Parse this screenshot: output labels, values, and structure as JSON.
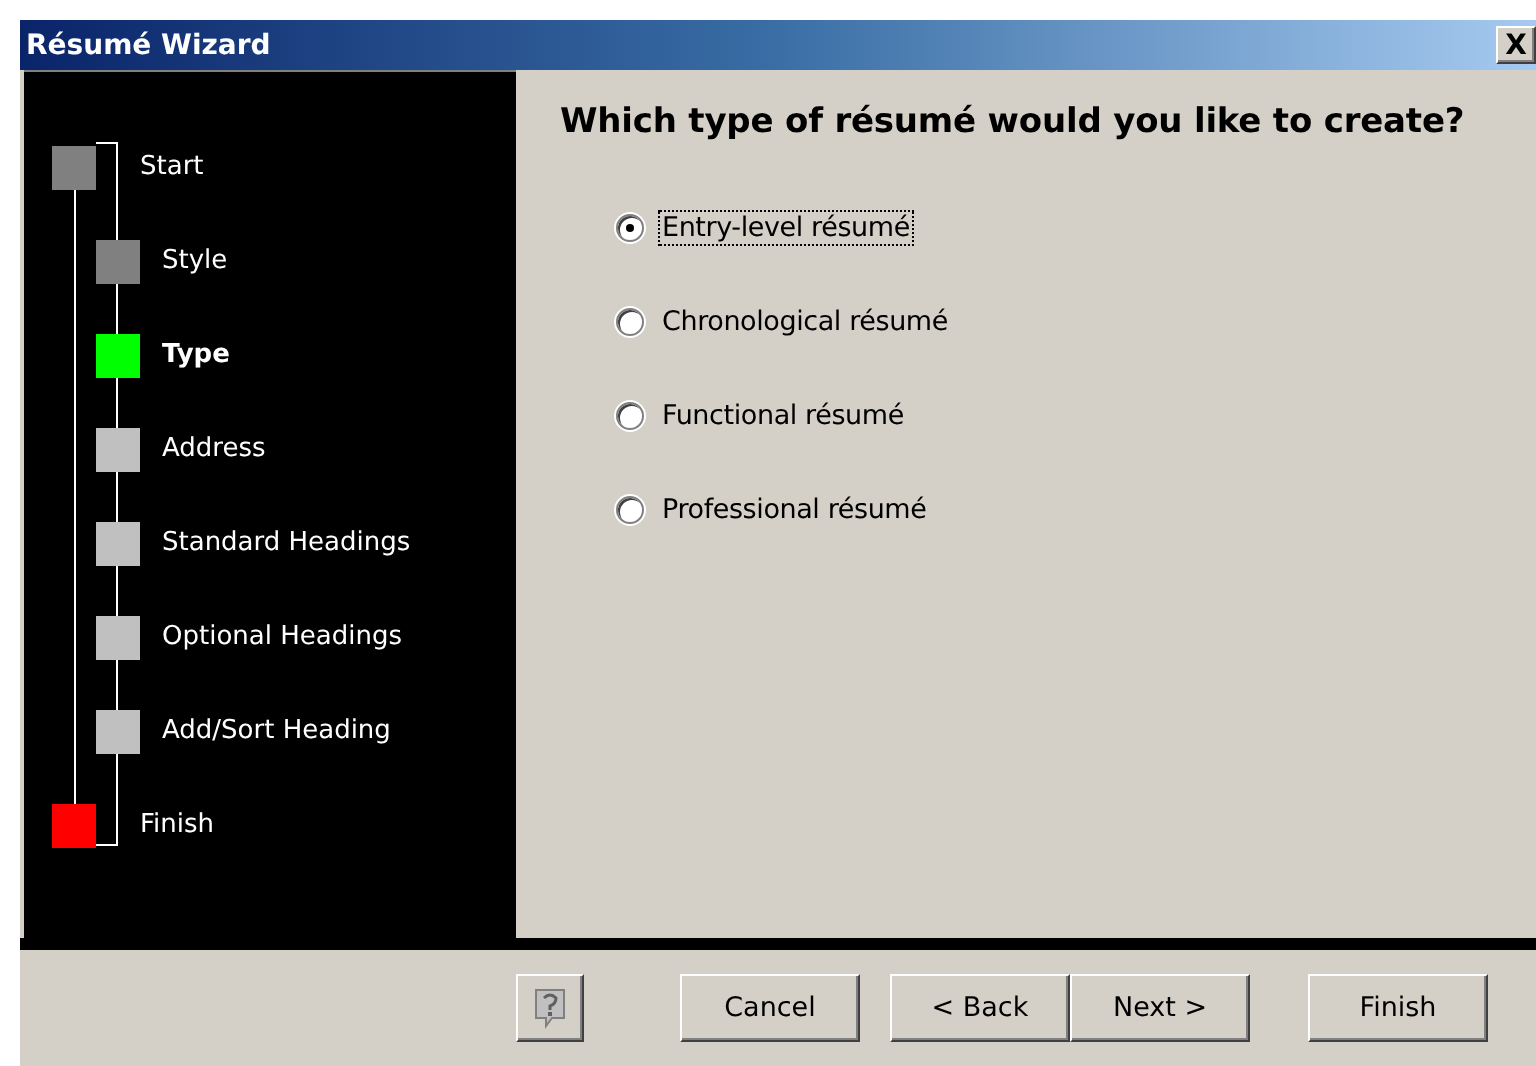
{
  "window": {
    "title": "Résumé Wizard",
    "close_label": "X"
  },
  "steps": [
    {
      "label": "Start",
      "kind": "endpoint",
      "color": "#808080",
      "current": false
    },
    {
      "label": "Style",
      "kind": "step",
      "color": "#808080",
      "current": false
    },
    {
      "label": "Type",
      "kind": "step",
      "color": "#00ff00",
      "current": true
    },
    {
      "label": "Address",
      "kind": "step",
      "color": "#c0c0c0",
      "current": false
    },
    {
      "label": "Standard Headings",
      "kind": "step",
      "color": "#c0c0c0",
      "current": false
    },
    {
      "label": "Optional Headings",
      "kind": "step",
      "color": "#c0c0c0",
      "current": false
    },
    {
      "label": "Add/Sort Heading",
      "kind": "step",
      "color": "#c0c0c0",
      "current": false
    },
    {
      "label": "Finish",
      "kind": "endpoint",
      "color": "#ff0000",
      "current": false
    }
  ],
  "question": "Which type of résumé would you like to create?",
  "options": [
    {
      "label": "Entry-level résumé",
      "selected": true,
      "focused": true
    },
    {
      "label": "Chronological résumé",
      "selected": false,
      "focused": false
    },
    {
      "label": "Functional résumé",
      "selected": false,
      "focused": false
    },
    {
      "label": "Professional résumé",
      "selected": false,
      "focused": false
    }
  ],
  "buttons": [
    {
      "label": "Cancel",
      "kind": "single"
    },
    {
      "label": "< Back",
      "kind": "pair"
    },
    {
      "label": "Next >",
      "kind": "pair"
    },
    {
      "label": "Finish",
      "kind": "single"
    }
  ]
}
